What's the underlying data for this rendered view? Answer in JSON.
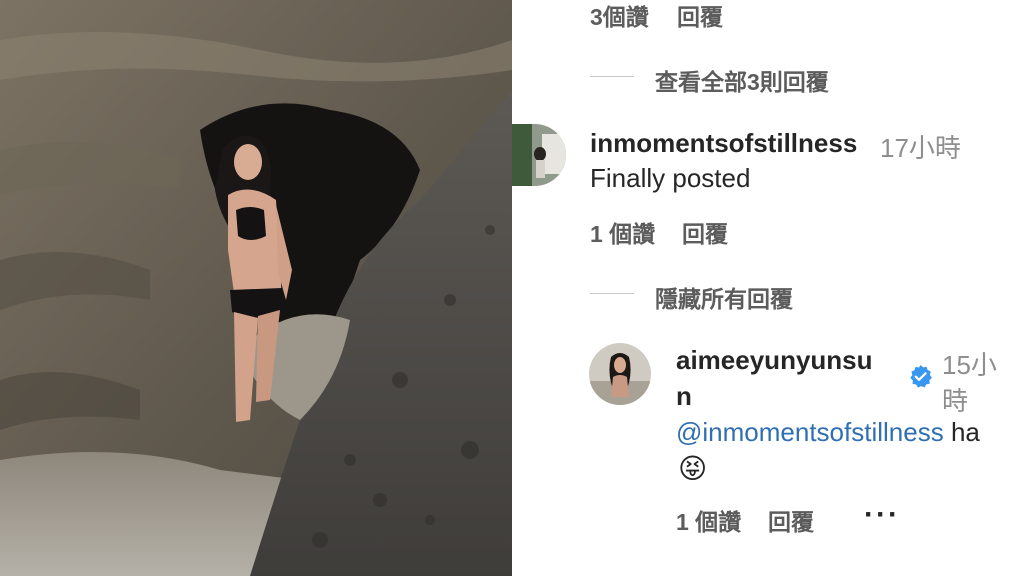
{
  "top_reply": {
    "likes": "3個讚",
    "reply": "回覆"
  },
  "view_all": "查看全部3則回覆",
  "comment": {
    "username": "inmomentsofstillness",
    "time": "17小時",
    "text": "Finally posted",
    "likes": "1 個讚",
    "reply": "回覆"
  },
  "hide_replies": "隱藏所有回覆",
  "reply": {
    "username_line1": "aimeeyunyunsu",
    "username_line2": "n",
    "verified_icon": "verified-badge-icon",
    "time_line1": "15小",
    "time_line2": "時",
    "mention": "@inmomentsofstillness",
    "text": " ha",
    "emoji": "😝",
    "likes": "1 個讚",
    "reply": "回覆",
    "more": "···"
  },
  "colors": {
    "verified": "#3897f0",
    "mention": "#2f6fb2",
    "muted": "#8e8e8e"
  }
}
